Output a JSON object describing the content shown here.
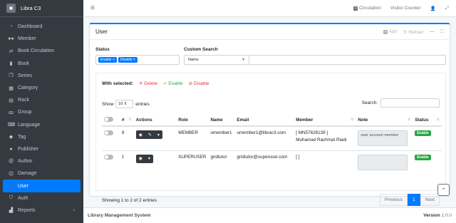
{
  "brand": {
    "name": "Libra C3"
  },
  "sidebar": {
    "items": [
      {
        "label": "Dashboard",
        "icon": "tachometer-icon"
      },
      {
        "label": "Member",
        "icon": "users-icon"
      },
      {
        "label": "Book Circulation",
        "icon": "exchange-icon"
      },
      {
        "label": "Book",
        "icon": "book-icon"
      },
      {
        "label": "Series",
        "icon": "copy-icon"
      },
      {
        "label": "Category",
        "icon": "th-icon"
      },
      {
        "label": "Rack",
        "icon": "table-icon"
      },
      {
        "label": "Group",
        "icon": "group-icon"
      },
      {
        "label": "Language",
        "icon": "keyboard-icon"
      },
      {
        "label": "Tag",
        "icon": "tag-icon"
      },
      {
        "label": "Publisher",
        "icon": "circle-icon"
      },
      {
        "label": "Author",
        "icon": "at-icon"
      },
      {
        "label": "Damage",
        "icon": "frown-icon"
      },
      {
        "label": "User",
        "icon": "user-icon"
      },
      {
        "label": "Auth",
        "icon": "shield-icon"
      },
      {
        "label": "Reports",
        "icon": "chart-icon"
      }
    ]
  },
  "topbar": {
    "circulation": "Circulation",
    "visitor": "Visitor Counter"
  },
  "card": {
    "title": "User",
    "add": "Add",
    "reload": "Reload"
  },
  "filters": {
    "status_label": "Status",
    "chips": [
      "Enable",
      "Disable"
    ],
    "custom_label": "Custom Search",
    "select_value": "Name"
  },
  "bulk": {
    "label": "With selected:",
    "delete": "Delete",
    "enable": "Enable",
    "disable": "Disable"
  },
  "length": {
    "show": "Show",
    "value": "10",
    "entries": "entries"
  },
  "search": {
    "label": "Search:"
  },
  "table": {
    "headers": [
      "#",
      "Actions",
      "Role",
      "Name",
      "Email",
      "Member",
      "Note",
      "Status"
    ],
    "rows": [
      {
        "num": "9",
        "role": "MEMBER",
        "name": "umember1",
        "email": "umember1@librac3.com",
        "member_id": "[ MN57628139 ]",
        "member_name": "Muhamad Rachmat Riadi",
        "note": "user account member",
        "status": "Enable"
      },
      {
        "num": "1",
        "role": "SUPERUSER",
        "name": "gridtutor",
        "email": "gridtutor@superuser.com",
        "member_id": "[ ]",
        "member_name": "",
        "note": "",
        "status": "Enable"
      }
    ]
  },
  "info": "Showing 1 to 2 of 2 entries",
  "pagination": {
    "prev": "Previous",
    "page": "1",
    "next": "Next"
  },
  "footer": {
    "left": "Library Management System",
    "version_label": "Version",
    "version": "1.0.0"
  }
}
